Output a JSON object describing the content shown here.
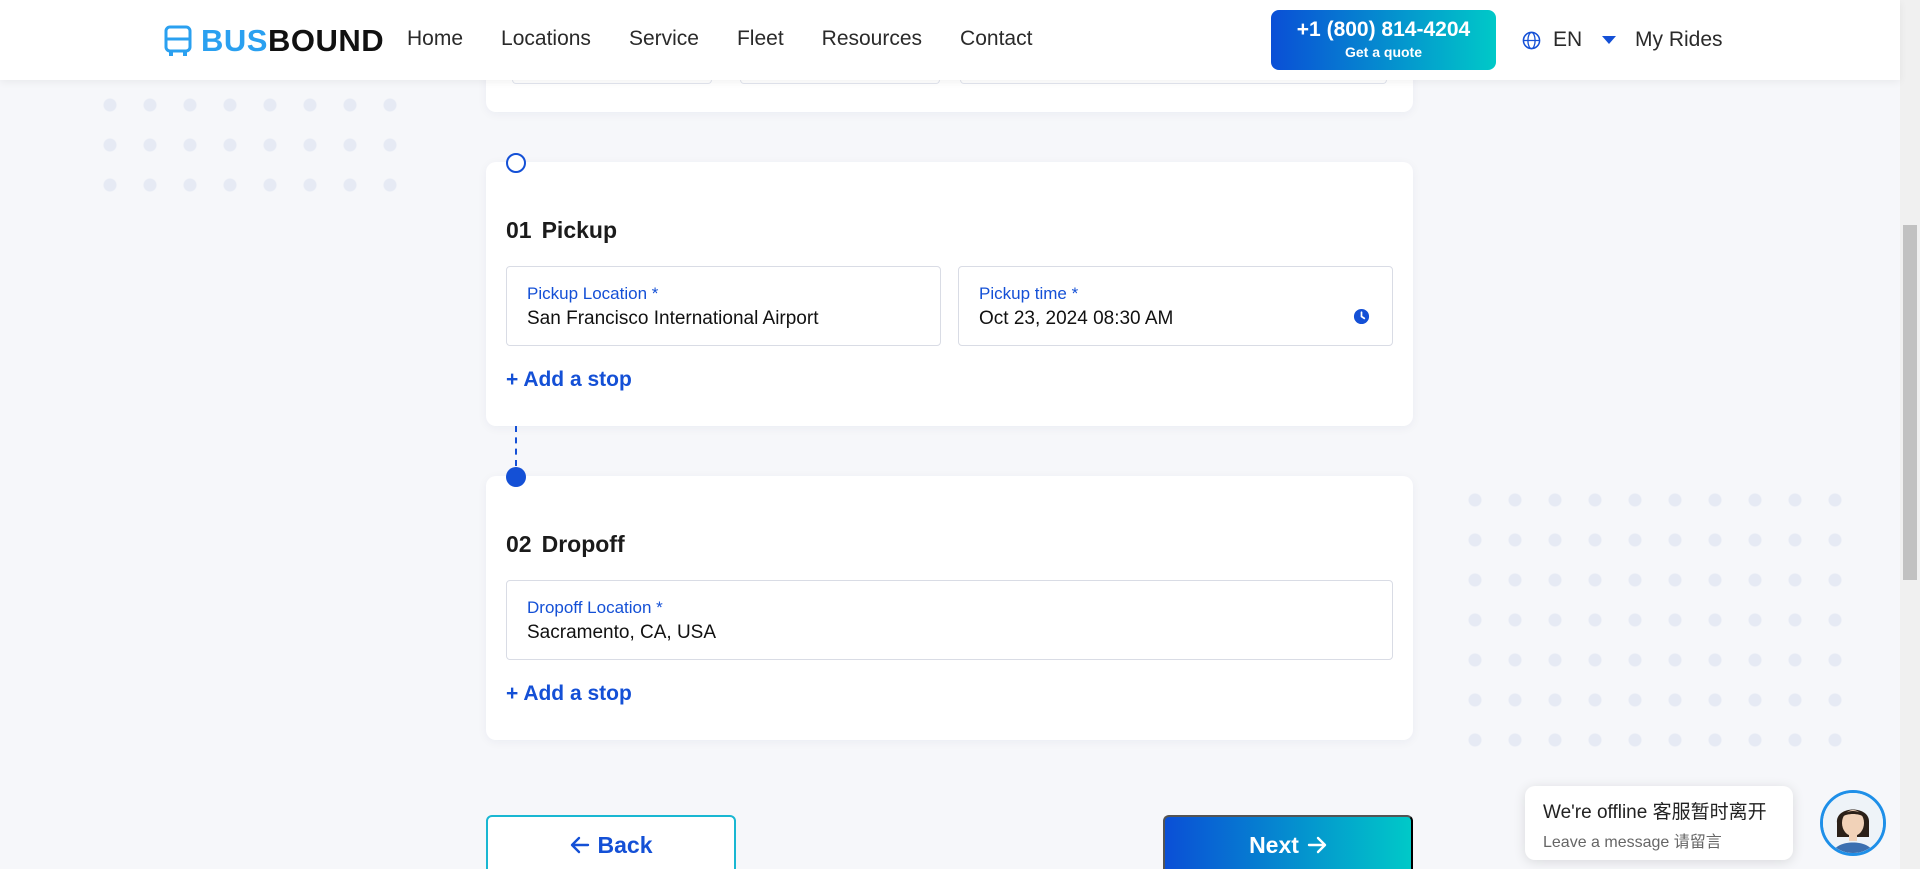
{
  "brand": {
    "part1": "BUS",
    "part2": "BOUND",
    "icon": "bus-icon"
  },
  "nav": {
    "items": [
      "Home",
      "Locations",
      "Service",
      "Fleet",
      "Resources",
      "Contact"
    ]
  },
  "header": {
    "phone": "+1 (800) 814-4204",
    "quote": "Get a quote",
    "language": "EN",
    "my_rides": "My Rides"
  },
  "pickup": {
    "number": "01",
    "title": "Pickup",
    "location_label": "Pickup Location *",
    "location_value": "San Francisco International Airport",
    "time_label": "Pickup time *",
    "time_value": "Oct 23, 2024 08:30 AM",
    "add_stop": "+ Add a stop"
  },
  "dropoff": {
    "number": "02",
    "title": "Dropoff",
    "location_label": "Dropoff Location *",
    "location_value": "Sacramento, CA, USA",
    "add_stop": "+ Add a stop"
  },
  "buttons": {
    "back": "Back",
    "next": "Next"
  },
  "chat": {
    "title": "We're offline 客服暂时离开",
    "subtitle": "Leave a message 请留言"
  },
  "colors": {
    "primary": "#1450d6",
    "accent": "#00c9c8",
    "logo_blue": "#2aa0f0"
  }
}
